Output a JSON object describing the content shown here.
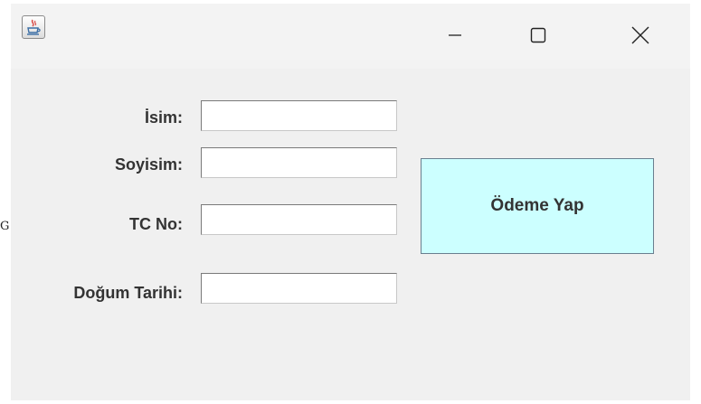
{
  "stray_text": "G",
  "titlebar": {
    "app_icon": "java-coffee-icon",
    "minimize_icon": "minimize-icon",
    "maximize_icon": "maximize-icon",
    "close_icon": "close-icon"
  },
  "form": {
    "name_label": "İsim:",
    "name_value": "",
    "surname_label": "Soyisim:",
    "surname_value": "",
    "tc_label": "TC No:",
    "tc_value": "",
    "birth_label": "Doğum Tarihi:",
    "birth_value": ""
  },
  "pay_button": {
    "label": "Ödeme Yap",
    "background": "#ccffff"
  }
}
